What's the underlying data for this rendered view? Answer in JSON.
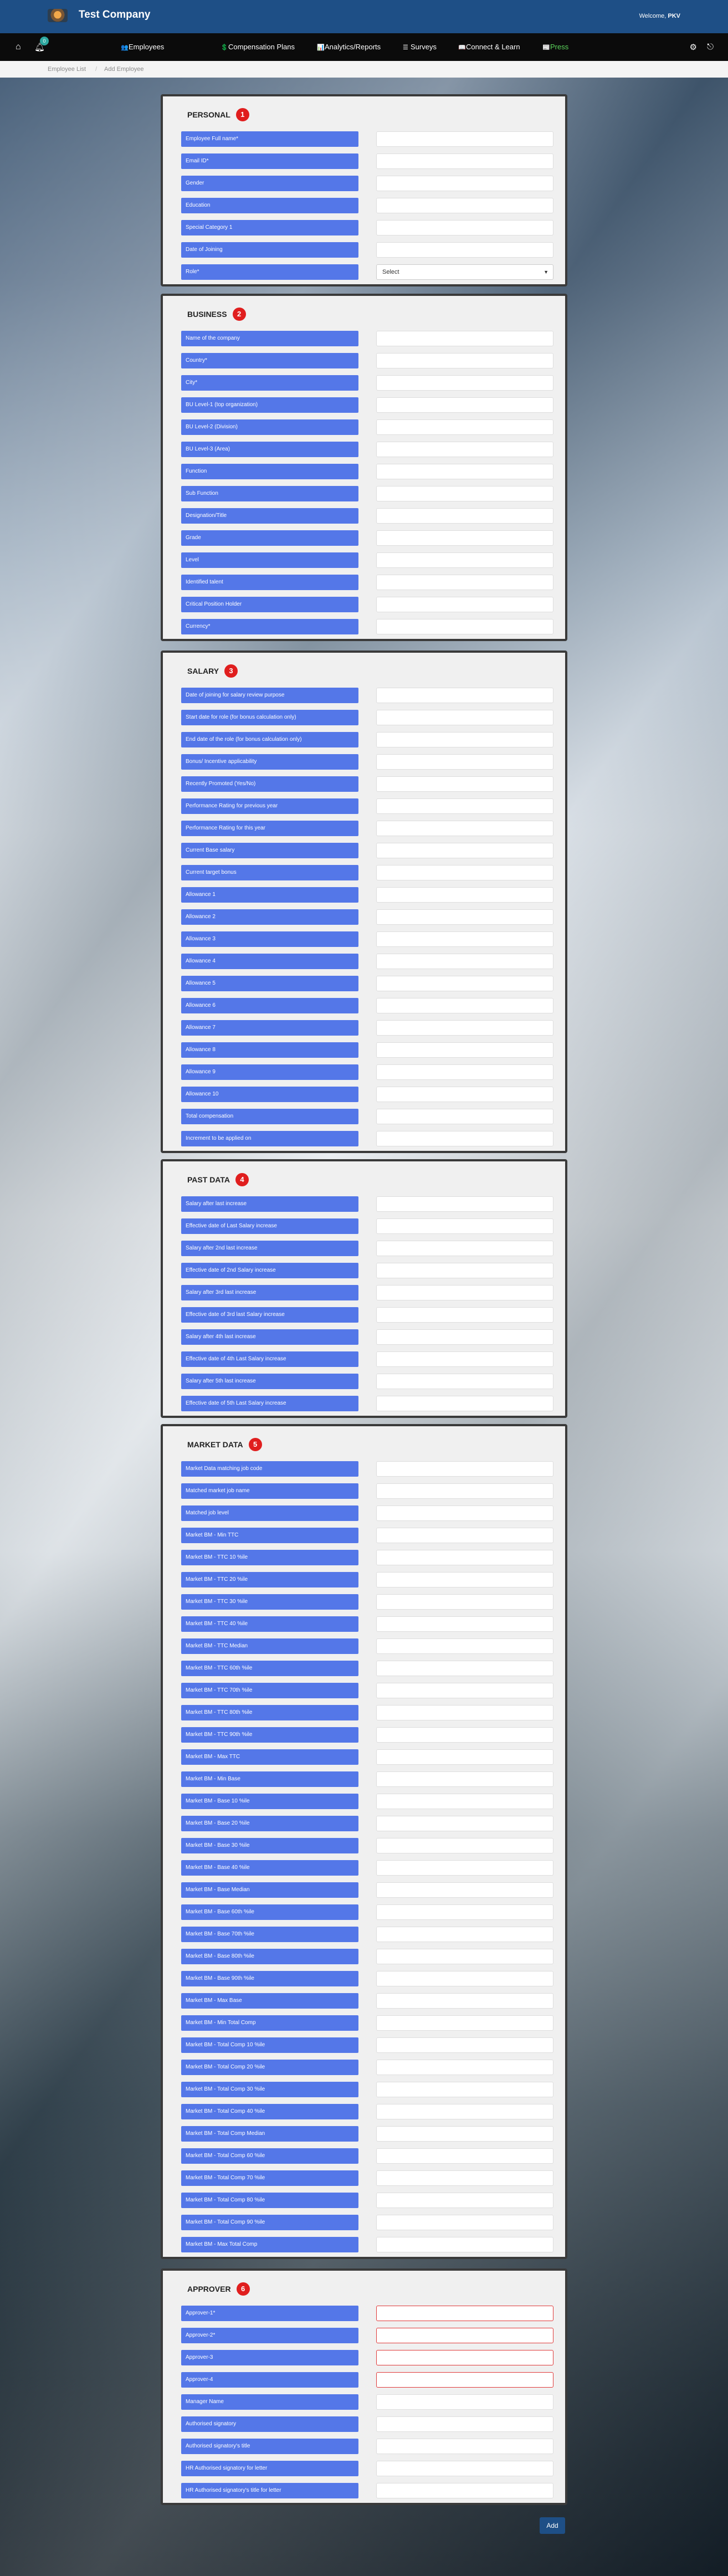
{
  "header": {
    "company": "Test Company",
    "welcome": "Welcome,",
    "user": "PKV"
  },
  "nav": {
    "badge": "0",
    "items": [
      {
        "label": "Employees",
        "icon": "users-icon",
        "glyph": "👥",
        "active": false
      },
      {
        "label": "Compensation Plans",
        "icon": "money-icon",
        "glyph": "💲",
        "active": false
      },
      {
        "label": "Analytics/Reports",
        "icon": "chart-icon",
        "glyph": "📊",
        "active": false
      },
      {
        "label": "Surveys",
        "icon": "list-icon",
        "glyph": "☰",
        "active": false
      },
      {
        "label": "Connect & Learn",
        "icon": "book-icon",
        "glyph": "📖",
        "active": false
      },
      {
        "label": "Press",
        "icon": "press-icon",
        "glyph": "📰",
        "active": true
      }
    ]
  },
  "breadcrumb": {
    "item1": "Employee List",
    "item2": "Add Employee"
  },
  "sections": [
    {
      "title": "PERSONAL",
      "num": "1",
      "fields": [
        "Employee Full name*",
        "Email ID*",
        "Gender",
        "Education",
        "Special Category 1",
        "Date of Joining",
        "Role*"
      ],
      "select": {
        "index": 6,
        "value": "Select"
      }
    },
    {
      "title": "BUSINESS",
      "num": "2",
      "fields": [
        "Name of the company",
        "Country*",
        "City*",
        "BU Level-1 (top organization)",
        "BU Level-2 (Division)",
        "BU Level-3 (Area)",
        "Function",
        "Sub Function",
        "Designation/Title",
        "Grade",
        "Level",
        "Identified talent",
        "Critical Position Holder",
        "Currency*"
      ]
    },
    {
      "title": "SALARY",
      "num": "3",
      "fields": [
        "Date of joining for salary review purpose",
        "Start date for role (for bonus calculation only)",
        "End date of the role (for bonus calculation only)",
        "Bonus/ Incentive applicability",
        "Recently Promoted (Yes/No)",
        "Performance Rating for previous year",
        "Performance Rating for this year",
        "Current Base salary",
        "Current target bonus",
        "Allowance 1",
        "Allowance 2",
        "Allowance 3",
        "Allowance 4",
        "Allowance 5",
        "Allowance 6",
        "Allowance 7",
        "Allowance 8",
        "Allowance 9",
        "Allowance 10",
        "Total compensation",
        "Increment to be applied on"
      ]
    },
    {
      "title": "PAST DATA",
      "num": "4",
      "fields": [
        "Salary after last increase",
        "Effective date of Last Salary increase",
        "Salary after 2nd last increase",
        "Effective date of 2nd Salary increase",
        "Salary after 3rd last increase",
        "Effective date of 3rd last Salary increase",
        "Salary after 4th last increase",
        "Effective date of 4th Last Salary increase",
        "Salary after 5th last increase",
        "Effective date of 5th Last Salary increase"
      ]
    },
    {
      "title": "MARKET DATA",
      "num": "5",
      "fields": [
        "Market Data matching job code",
        "Matched market job name",
        "Matched job level",
        "Market BM - Min TTC",
        "Market BM - TTC 10 %ile",
        "Market BM - TTC 20 %ile",
        "Market BM - TTC 30 %ile",
        "Market BM - TTC 40 %ile",
        "Market BM - TTC Median",
        "Market BM - TTC 60th %ile",
        "Market BM - TTC 70th %ile",
        "Market BM - TTC 80th %ile",
        "Market BM - TTC 90th %ile",
        "Market BM - Max TTC",
        "Market BM - Min Base",
        "Market BM - Base 10 %ile",
        "Market BM - Base 20 %ile",
        "Market BM - Base 30 %ile",
        "Market BM - Base 40 %ile",
        "Market BM - Base Median",
        "Market BM - Base 60th %ile",
        "Market BM - Base 70th %ile",
        "Market BM - Base 80th %ile",
        "Market BM - Base 90th %ile",
        "Market BM - Max Base",
        "Market BM - Min Total Comp",
        "Market BM - Total Comp 10 %ile",
        "Market BM - Total Comp 20 %ile",
        "Market BM - Total Comp 30 %ile",
        "Market BM - Total Comp 40 %ile",
        "Market BM - Total Comp Median",
        "Market BM - Total Comp 60 %ile",
        "Market BM - Total Comp 70 %ile",
        "Market BM - Total Comp 80 %ile",
        "Market BM - Total Comp 90 %ile",
        "Market BM - Max Total Comp"
      ]
    },
    {
      "title": "APPROVER",
      "num": "6",
      "fields": [
        "Approver-1*",
        "Approver-2*",
        "Approver-3",
        "Approver-4",
        "Manager Name",
        "Authorised signatory",
        "Authorised signatory's title",
        "HR Authorised signatory for letter",
        "HR Authorised signatory's title for letter"
      ],
      "required": [
        0,
        1,
        2,
        3
      ]
    }
  ],
  "actions": {
    "add": "Add"
  },
  "colors": {
    "topbar": "#1e4f86",
    "label_bg": "#5477e8",
    "badge": "#e01e1e",
    "nav_active": "#5cd65c"
  }
}
